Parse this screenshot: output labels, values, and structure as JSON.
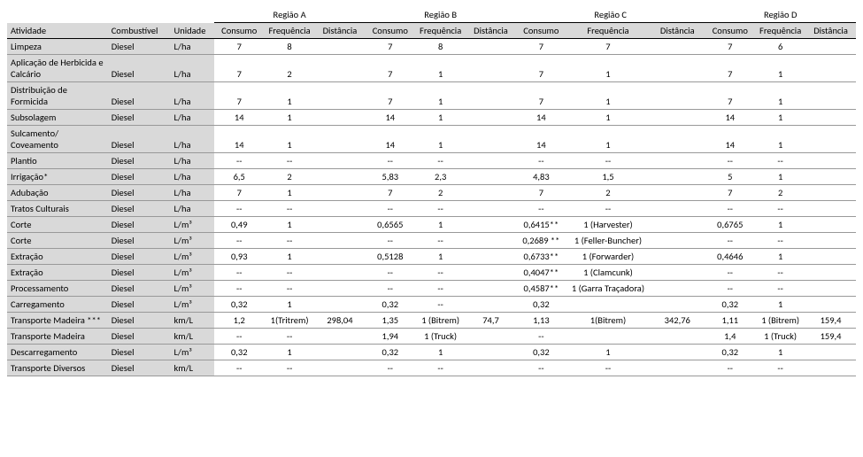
{
  "headers": {
    "regions": [
      "Região A",
      "Região B",
      "Região C",
      "Região D"
    ],
    "activity": "Atividade",
    "fuel": "Combustível",
    "unit": "Unidade",
    "cols": [
      "Consumo",
      "Frequência",
      "Distância"
    ]
  },
  "rows": [
    {
      "activity": "Limpeza",
      "fuel": "Diesel",
      "unit": "L/ha",
      "a": [
        "7",
        "8",
        ""
      ],
      "b": [
        "7",
        "8",
        ""
      ],
      "c": [
        "7",
        "7",
        ""
      ],
      "d": [
        "7",
        "6",
        ""
      ]
    },
    {
      "activity": "Aplicação de Herbicida e Calcário",
      "fuel": "Diesel",
      "unit": "L/ha",
      "a": [
        "7",
        "2",
        ""
      ],
      "b": [
        "7",
        "1",
        ""
      ],
      "c": [
        "7",
        "1",
        ""
      ],
      "d": [
        "7",
        "1",
        ""
      ]
    },
    {
      "activity": "Distribuição de Formicida",
      "fuel": "Diesel",
      "unit": "L/ha",
      "a": [
        "7",
        "1",
        ""
      ],
      "b": [
        "7",
        "1",
        ""
      ],
      "c": [
        "7",
        "1",
        ""
      ],
      "d": [
        "7",
        "1",
        ""
      ]
    },
    {
      "activity": "Subsolagem",
      "fuel": "Diesel",
      "unit": "L/ha",
      "a": [
        "14",
        "1",
        ""
      ],
      "b": [
        "14",
        "1",
        ""
      ],
      "c": [
        "14",
        "1",
        ""
      ],
      "d": [
        "14",
        "1",
        ""
      ]
    },
    {
      "activity": "Sulcamento/ Coveamento",
      "fuel": "Diesel",
      "unit": "L/ha",
      "a": [
        "14",
        "1",
        ""
      ],
      "b": [
        "14",
        "1",
        ""
      ],
      "c": [
        "14",
        "1",
        ""
      ],
      "d": [
        "14",
        "1",
        ""
      ]
    },
    {
      "activity": "Plantio",
      "fuel": "Diesel",
      "unit": "L/ha",
      "a": [
        "--",
        "--",
        ""
      ],
      "b": [
        "--",
        "--",
        ""
      ],
      "c": [
        "--",
        "--",
        ""
      ],
      "d": [
        "--",
        "--",
        ""
      ]
    },
    {
      "activity": "Irrigação*",
      "fuel": "Diesel",
      "unit": "L/ha",
      "a": [
        "6,5",
        "2",
        ""
      ],
      "b": [
        "5,83",
        "2,3",
        ""
      ],
      "c": [
        "4,83",
        "1,5",
        ""
      ],
      "d": [
        "5",
        "1",
        ""
      ]
    },
    {
      "activity": "Adubação",
      "fuel": "Diesel",
      "unit": "L/ha",
      "a": [
        "7",
        "1",
        ""
      ],
      "b": [
        "7",
        "2",
        ""
      ],
      "c": [
        "7",
        "2",
        ""
      ],
      "d": [
        "7",
        "2",
        ""
      ]
    },
    {
      "activity": "Tratos Culturais",
      "fuel": "Diesel",
      "unit": "L/ha",
      "a": [
        "--",
        "--",
        ""
      ],
      "b": [
        "--",
        "--",
        ""
      ],
      "c": [
        "--",
        "--",
        ""
      ],
      "d": [
        "--",
        "--",
        ""
      ]
    },
    {
      "activity": "Corte",
      "fuel": "Diesel",
      "unit": "L/m³",
      "a": [
        "0,49",
        "1",
        ""
      ],
      "b": [
        "0,6565",
        "1",
        ""
      ],
      "c": [
        "0,6415**",
        "1 (Harvester)",
        ""
      ],
      "d": [
        "0,6765",
        "1",
        ""
      ]
    },
    {
      "activity": "Corte",
      "fuel": "Diesel",
      "unit": "L/m³",
      "a": [
        "--",
        "--",
        ""
      ],
      "b": [
        "--",
        "--",
        ""
      ],
      "c": [
        "0,2689 **",
        "1 (Feller-Buncher)",
        ""
      ],
      "d": [
        "--",
        "--",
        ""
      ]
    },
    {
      "activity": "Extração",
      "fuel": "Diesel",
      "unit": "L/m³",
      "a": [
        "0,93",
        "1",
        ""
      ],
      "b": [
        "0,5128",
        "1",
        ""
      ],
      "c": [
        "0,6733**",
        "1 (Forwarder)",
        ""
      ],
      "d": [
        "0,4646",
        "1",
        ""
      ]
    },
    {
      "activity": "Extração",
      "fuel": "Diesel",
      "unit": "L/m³",
      "a": [
        "--",
        "--",
        ""
      ],
      "b": [
        "--",
        "--",
        ""
      ],
      "c": [
        "0,4047**",
        "1 (Clamcunk)",
        ""
      ],
      "d": [
        "--",
        "--",
        ""
      ]
    },
    {
      "activity": "Processamento",
      "fuel": "Diesel",
      "unit": "L/m³",
      "a": [
        "--",
        "--",
        ""
      ],
      "b": [
        "--",
        "--",
        ""
      ],
      "c": [
        "0,4587**",
        "1 (Garra Traçadora)",
        ""
      ],
      "d": [
        "--",
        "--",
        ""
      ]
    },
    {
      "activity": "Carregamento",
      "fuel": "Diesel",
      "unit": "L/m³",
      "a": [
        "0,32",
        "1",
        ""
      ],
      "b": [
        "0,32",
        "--",
        ""
      ],
      "c": [
        "0,32",
        "",
        ""
      ],
      "d": [
        "0,32",
        "1",
        ""
      ]
    },
    {
      "activity": "Transporte Madeira ***",
      "fuel": "Diesel",
      "unit": "km/L",
      "a": [
        "1,2",
        "1(Tritrem)",
        "298,04"
      ],
      "b": [
        "1,35",
        "1 (Bitrem)",
        "74,7"
      ],
      "c": [
        "1,13",
        "1(Bitrem)",
        "342,76"
      ],
      "d": [
        "1,11",
        "1 (Bitrem)",
        "159,4"
      ]
    },
    {
      "activity": "Transporte Madeira",
      "fuel": "Diesel",
      "unit": "km/L",
      "a": [
        "--",
        "--",
        ""
      ],
      "b": [
        "1,94",
        "1 (Truck)",
        ""
      ],
      "c": [
        "--",
        "",
        ""
      ],
      "d": [
        "1,4",
        "1 (Truck)",
        "159,4"
      ]
    },
    {
      "activity": "Descarregamento",
      "fuel": "Diesel",
      "unit": "L/m³",
      "a": [
        "0,32",
        "1",
        ""
      ],
      "b": [
        "0,32",
        "1",
        ""
      ],
      "c": [
        "0,32",
        "1",
        ""
      ],
      "d": [
        "0,32",
        "1",
        ""
      ]
    },
    {
      "activity": "Transporte Diversos",
      "fuel": "Diesel",
      "unit": "km/L",
      "a": [
        "--",
        "--",
        ""
      ],
      "b": [
        "--",
        "--",
        ""
      ],
      "c": [
        "--",
        "--",
        ""
      ],
      "d": [
        "--",
        "--",
        ""
      ]
    }
  ]
}
